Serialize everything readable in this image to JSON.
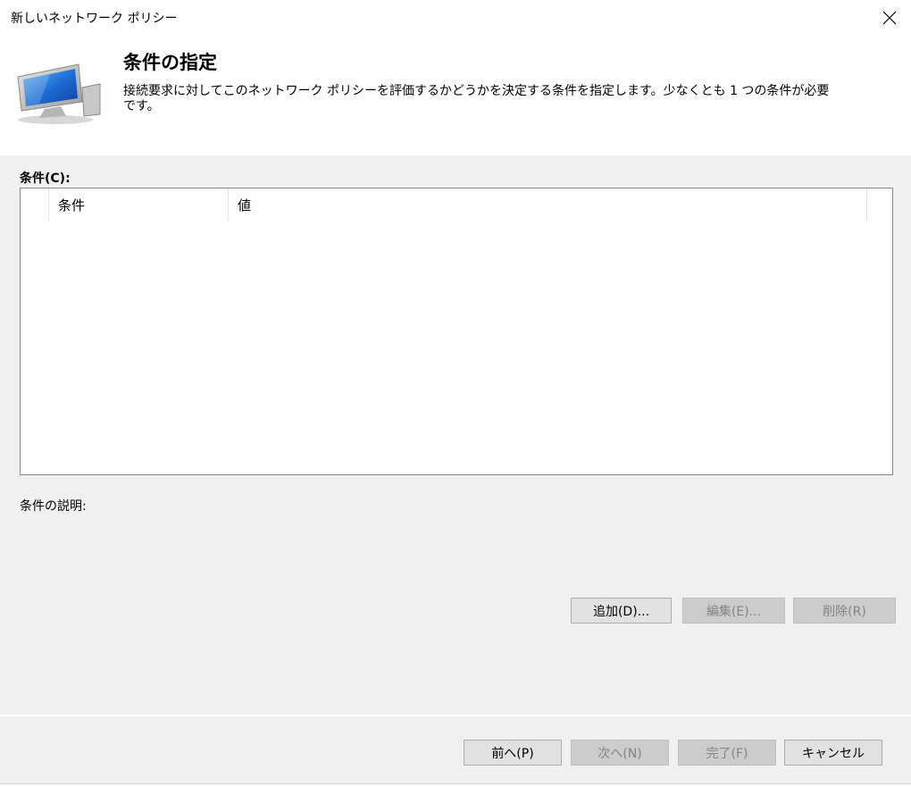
{
  "window": {
    "title": "新しいネットワーク ポリシー"
  },
  "header": {
    "icon": "computer-monitor-icon",
    "title": "条件の指定",
    "description": "接続要求に対してこのネットワーク ポリシーを評価するかどうかを決定する条件を指定します。少なくとも 1 つの条件が必要\nです。"
  },
  "conditions": {
    "label": "条件(C):",
    "columns": [
      "条件",
      "値"
    ],
    "rows": []
  },
  "description_label": "条件の説明:",
  "actions": {
    "add": "追加(D)...",
    "edit": "編集(E)...",
    "delete": "削除(R)"
  },
  "footer": {
    "prev": "前へ(P)",
    "next": "次へ(N)",
    "finish": "完了(F)",
    "cancel": "キャンセル"
  }
}
